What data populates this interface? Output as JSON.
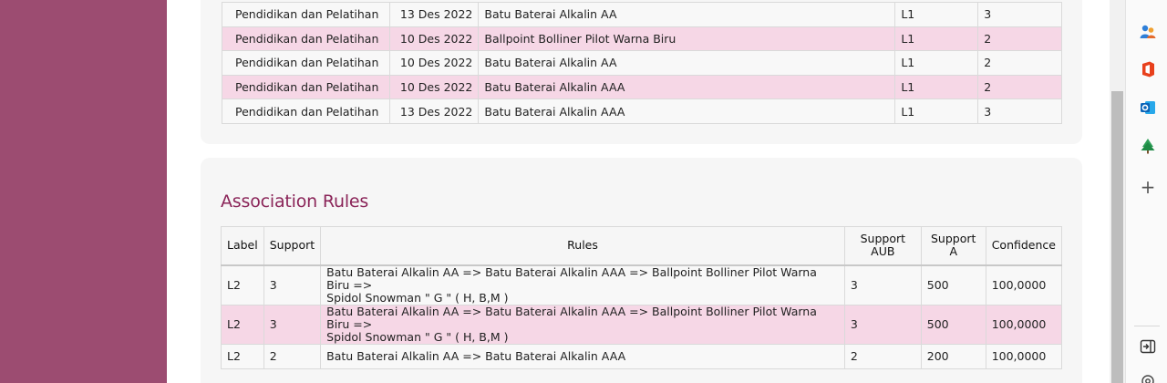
{
  "items_table": {
    "rows": [
      {
        "kategori": "Pendidikan dan Pelatihan",
        "tanggal": "13 Des 2022",
        "barang": "Batu Baterai Alkalin AA",
        "label": "L1",
        "support": "3"
      },
      {
        "kategori": "Pendidikan dan Pelatihan",
        "tanggal": "10 Des 2022",
        "barang": "Ballpoint Bolliner Pilot Warna Biru",
        "label": "L1",
        "support": "2"
      },
      {
        "kategori": "Pendidikan dan Pelatihan",
        "tanggal": "10 Des 2022",
        "barang": "Batu Baterai Alkalin AA",
        "label": "L1",
        "support": "2"
      },
      {
        "kategori": "Pendidikan dan Pelatihan",
        "tanggal": "10 Des 2022",
        "barang": "Batu Baterai Alkalin AAA",
        "label": "L1",
        "support": "2"
      },
      {
        "kategori": "Pendidikan dan Pelatihan",
        "tanggal": "13 Des 2022",
        "barang": "Batu Baterai Alkalin AAA",
        "label": "L1",
        "support": "3"
      }
    ]
  },
  "association": {
    "title": "Association Rules",
    "headers": {
      "label": "Label",
      "support": "Support",
      "rules": "Rules",
      "support_aub_line1": "Support",
      "support_aub_line2": "AUB",
      "support_a_line1": "Support",
      "support_a_line2": "A",
      "confidence": "Confidence"
    },
    "rows": [
      {
        "label": "L2",
        "support": "3",
        "rules_line1": "Batu Baterai Alkalin AA => Batu Baterai Alkalin AAA => Ballpoint Bolliner Pilot Warna Biru =>",
        "rules_line2": "Spidol Snowman \" G \" ( H, B,M )",
        "support_aub": "3",
        "support_a": "500",
        "confidence": "100,0000"
      },
      {
        "label": "L2",
        "support": "3",
        "rules_line1": "Batu Baterai Alkalin AA => Batu Baterai Alkalin AAA => Ballpoint Bolliner Pilot Warna Biru =>",
        "rules_line2": "Spidol Snowman \" G \" ( H, B,M )",
        "support_aub": "3",
        "support_a": "500",
        "confidence": "100,0000"
      },
      {
        "label": "L2",
        "support": "2",
        "rules_line1": "Batu Baterai Alkalin AA => Batu Baterai Alkalin AAA",
        "rules_line2": "",
        "support_aub": "2",
        "support_a": "200",
        "confidence": "100,0000"
      }
    ]
  },
  "edge_sidebar": {
    "icons": [
      "copilot-people-icon",
      "office-icon",
      "outlook-icon",
      "tree-icon",
      "plus-icon",
      "sidebar-toggle-icon",
      "settings-icon"
    ],
    "plus_glyph": "+"
  },
  "colors": {
    "sidebar": "#9c4c71",
    "row_highlight": "#f6d7e6",
    "title": "#8a2458"
  }
}
